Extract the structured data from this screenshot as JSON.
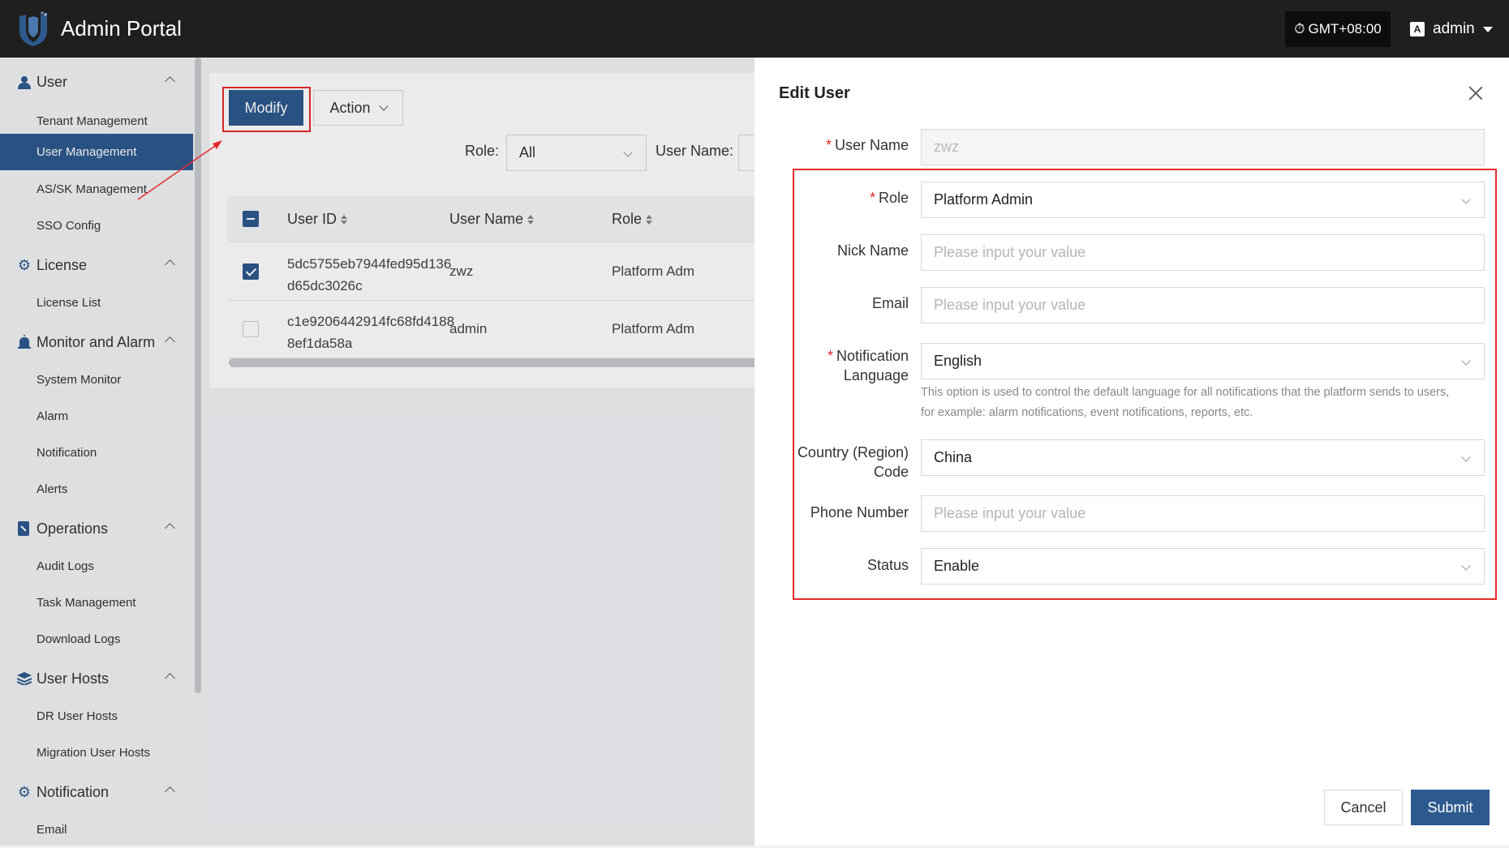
{
  "app": {
    "title": "Admin Portal",
    "timezone": "GMT+08:00",
    "username": "admin"
  },
  "sidebar": {
    "groups": [
      {
        "label": "User",
        "items": [
          "Tenant Management",
          "User Management",
          "AS/SK Management",
          "SSO Config"
        ]
      },
      {
        "label": "License",
        "items": [
          "License List"
        ]
      },
      {
        "label": "Monitor and Alarm",
        "items": [
          "System Monitor",
          "Alarm",
          "Notification",
          "Alerts"
        ]
      },
      {
        "label": "Operations",
        "items": [
          "Audit Logs",
          "Task Management",
          "Download Logs"
        ]
      },
      {
        "label": "User Hosts",
        "items": [
          "DR User Hosts",
          "Migration User Hosts"
        ]
      },
      {
        "label": "Notification",
        "items": [
          "Email"
        ]
      }
    ],
    "active_item": "User Management"
  },
  "toolbar": {
    "modify_label": "Modify",
    "action_label": "Action"
  },
  "filters": {
    "role_label": "Role:",
    "role_value": "All",
    "user_name_label": "User Name:"
  },
  "table": {
    "columns": [
      "User ID",
      "User Name",
      "Role"
    ],
    "rows": [
      {
        "id_line1": "5dc5755eb7944fed95d136",
        "id_line2": "d65dc3026c",
        "name": "zwz",
        "role": "Platform Adm",
        "checked": true
      },
      {
        "id_line1": "c1e9206442914fc68fd4188",
        "id_line2": "8ef1da58a",
        "name": "admin",
        "role": "Platform Adm",
        "checked": false
      }
    ]
  },
  "drawer": {
    "title": "Edit User",
    "fields": {
      "user_name": {
        "label": "User Name",
        "value": "zwz"
      },
      "role": {
        "label": "Role",
        "value": "Platform Admin"
      },
      "nick_name": {
        "label": "Nick Name",
        "placeholder": "Please input your value"
      },
      "email": {
        "label": "Email",
        "placeholder": "Please input your value"
      },
      "notification_language": {
        "label_line1": "Notification",
        "label_line2": "Language",
        "value": "English",
        "hint_line1": "This option is used to control the default language for all notifications that the platform sends to users,",
        "hint_line2": "for example: alarm notifications, event notifications, reports, etc."
      },
      "country_code": {
        "label_line1": "Country (Region)",
        "label_line2": "Code",
        "value": "China"
      },
      "phone_number": {
        "label": "Phone Number",
        "placeholder": "Please input your value"
      },
      "status": {
        "label": "Status",
        "value": "Enable"
      }
    },
    "cancel_label": "Cancel",
    "submit_label": "Submit"
  },
  "colors": {
    "primary": "#2d5a8e",
    "topbar": "#1f1f1f",
    "highlight": "#e52b2b",
    "required": "#e52b2b"
  }
}
